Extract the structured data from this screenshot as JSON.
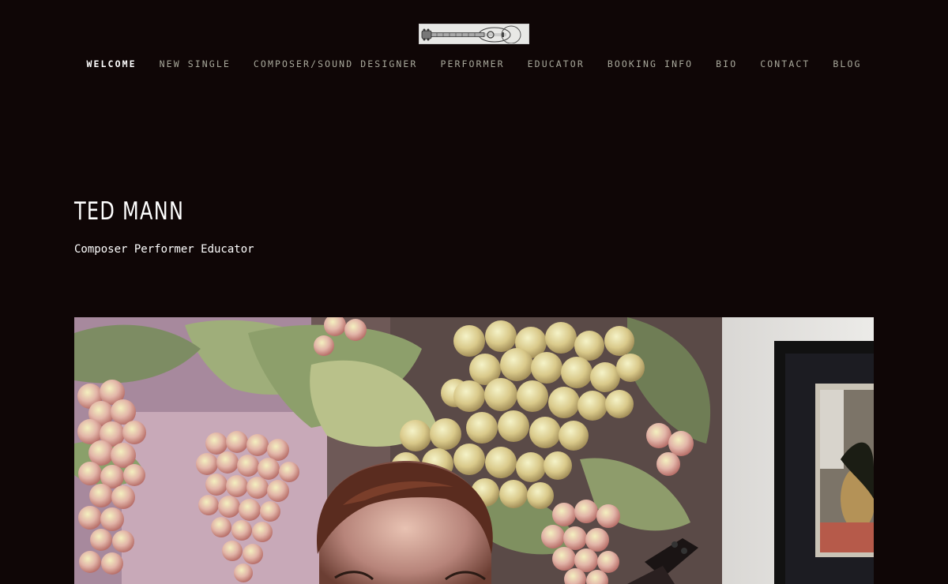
{
  "logo": {
    "icon": "guitar-icon"
  },
  "nav": {
    "items": [
      {
        "label": "WELCOME",
        "active": true
      },
      {
        "label": "NEW SINGLE"
      },
      {
        "label": "COMPOSER/SOUND DESIGNER"
      },
      {
        "label": "PERFORMER"
      },
      {
        "label": "EDUCATOR"
      },
      {
        "label": "BOOKING INFO"
      },
      {
        "label": "BIO"
      },
      {
        "label": "CONTACT"
      },
      {
        "label": "BLOG"
      }
    ]
  },
  "hero": {
    "title": "TED MANN",
    "subtitle": "Composer Performer Educator"
  },
  "colors": {
    "background": "#0f0606",
    "nav_text": "#a8a89b",
    "nav_active": "#ffffff",
    "heading": "#ffffff"
  }
}
